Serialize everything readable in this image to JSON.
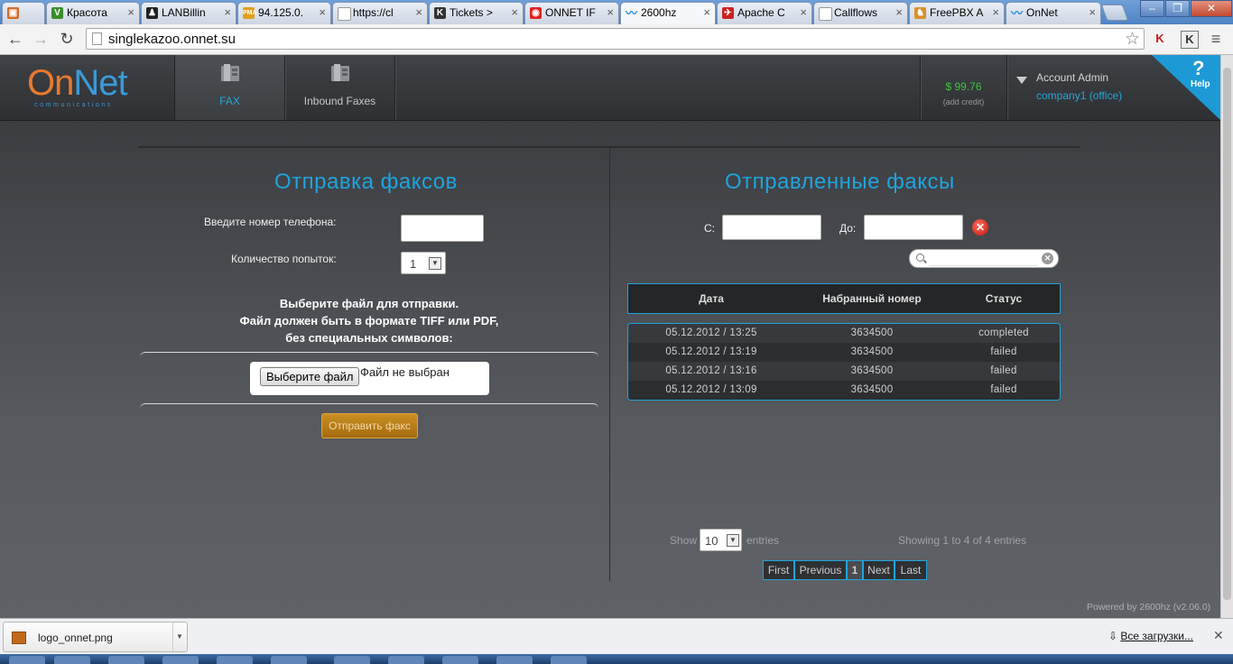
{
  "browser": {
    "tabs": [
      {
        "title": "",
        "icon": "gift-icon",
        "color": "#d06b2a",
        "x": 0
      },
      {
        "title": "Красота",
        "icon": "v-icon",
        "color": "#3a8d2c"
      },
      {
        "title": "LANBillin",
        "icon": "penguin-icon",
        "color": "#222"
      },
      {
        "title": "94.125.0.",
        "icon": "pma-icon",
        "color": "#e0a020"
      },
      {
        "title": "https://cl",
        "icon": "page-icon",
        "color": "#999"
      },
      {
        "title": "Tickets >",
        "icon": "k-icon",
        "color": "#333"
      },
      {
        "title": "ONNET IF",
        "icon": "onnet-icon",
        "color": "#d22"
      },
      {
        "title": "2600hz",
        "icon": "wave-icon",
        "color": "#2a8dd4"
      },
      {
        "title": "Apache C",
        "icon": "flag-icon",
        "color": "#c22"
      },
      {
        "title": "Callflows",
        "icon": "page-icon",
        "color": "#999"
      },
      {
        "title": "FreePBX A",
        "icon": "freepbx-icon",
        "color": "#d9902a"
      },
      {
        "title": "OnNet",
        "icon": "wave-icon",
        "color": "#2a8dd4"
      }
    ],
    "window_buttons": {
      "minimize": "–",
      "restore": "❐",
      "close": "✕"
    },
    "url": "singlekazoo.onnet.su"
  },
  "header": {
    "logo": {
      "on": "On",
      "net": "Net",
      "sub": "communications"
    },
    "nav": [
      {
        "label": "FAX",
        "active": true
      },
      {
        "label": "Inbound Faxes",
        "active": false
      }
    ],
    "credit": {
      "amount": "$ 99.76",
      "add": "(add credit)"
    },
    "account": {
      "name": "Account Admin",
      "company": "company1 (office)"
    },
    "help": {
      "symbol": "?",
      "label": "Help"
    }
  },
  "send_fax": {
    "title": "Отправка факсов",
    "phone_label": "Введите номер телефона:",
    "phone_value": "",
    "attempts_label": "Количество попыток:",
    "attempts_value": "1",
    "instructions": [
      "Выберите файл для отправки.",
      "Файл должен быть в формате TIFF или PDF,",
      "без специальных символов:"
    ],
    "file_button": "Выберите файл",
    "file_status": "Файл не выбран",
    "send_button": "Отправить факс"
  },
  "sent_faxes": {
    "title": "Отправленные факсы",
    "from_label": "С:",
    "to_label": "До:",
    "from_value": "",
    "to_value": "",
    "search_value": "",
    "columns": [
      "Дата",
      "Набранный номер",
      "Статус"
    ],
    "rows": [
      {
        "date": "05.12.2012 / 13:25",
        "number": "3634500",
        "status": "completed"
      },
      {
        "date": "05.12.2012 / 13:19",
        "number": "3634500",
        "status": "failed"
      },
      {
        "date": "05.12.2012 / 13:16",
        "number": "3634500",
        "status": "failed"
      },
      {
        "date": "05.12.2012 / 13:09",
        "number": "3634500",
        "status": "failed"
      }
    ],
    "length": {
      "show": "Show",
      "value": "10",
      "entries": "entries"
    },
    "info": "Showing 1 to 4 of 4 entries",
    "pager": {
      "first": "First",
      "previous": "Previous",
      "current": "1",
      "next": "Next",
      "last": "Last"
    }
  },
  "footer": {
    "powered_by": "Powered by 2600hz   (v2.06.0)"
  },
  "downloads": {
    "file": "logo_onnet.png",
    "show_all": "Все загрузки...",
    "close": "✕"
  },
  "colors": {
    "accent": "#1fa4dc",
    "send_button": "#b97c19",
    "credit": "#3fc43f",
    "help": "#1d9ad6"
  }
}
